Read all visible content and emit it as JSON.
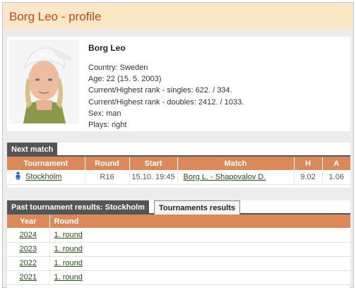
{
  "page": {
    "title": "Borg Leo - profile"
  },
  "player": {
    "name": "Borg Leo",
    "country": "Country: Sweden",
    "age": "Age: 22 (15. 5. 2003)",
    "rank_singles": "Current/Highest rank - singles: 622. / 334.",
    "rank_doubles": "Current/Highest rank - doubles: 2412. / 1033.",
    "sex": "Sex: man",
    "plays": "Plays: right"
  },
  "next_match": {
    "tab_label": "Next match",
    "headers": {
      "tournament": "Tournament",
      "round": "Round",
      "start": "Start",
      "match": "Match",
      "h": "H",
      "a": "A"
    },
    "row": {
      "tournament": "Stockholm",
      "round": "R16",
      "start": "15.10. 19:45",
      "match": "Borg L. - Shapovalov D.",
      "h": "9.02",
      "a": "1.06"
    }
  },
  "past_results": {
    "tab_label": "Past tournament results: Stockholm",
    "tab2_label": "Tournaments results",
    "headers": {
      "year": "Year",
      "round": "Round"
    },
    "rows": [
      {
        "year": "2024",
        "round": "1. round"
      },
      {
        "year": "2023",
        "round": "1. round"
      },
      {
        "year": "2022",
        "round": "1. round"
      },
      {
        "year": "2021",
        "round": "1. round"
      }
    ]
  }
}
